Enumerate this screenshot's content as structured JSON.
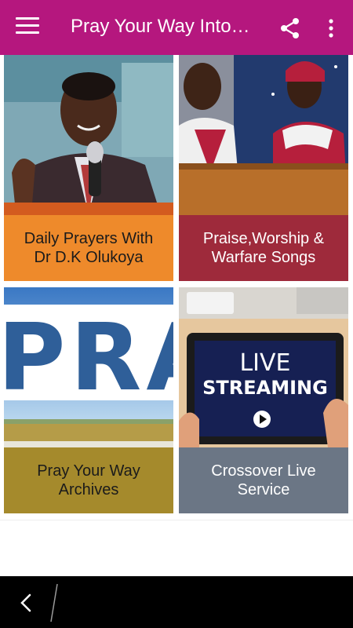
{
  "app_bar": {
    "title": "Pray Your Way Into…",
    "background_color": "#b5177e",
    "menu_icon": "hamburger-menu-icon",
    "share_icon": "share-icon",
    "more_icon": "more-vert-icon"
  },
  "tiles": [
    {
      "label_line1": "Daily Prayers With",
      "label_line2": "Dr D.K Olukoya",
      "label_color": "#ee8a2b",
      "image": "preacher-with-microphone"
    },
    {
      "label_line1": "Praise,Worship &",
      "label_line2": "Warfare Songs",
      "label_color": "#9e2a3b",
      "image": "choir-at-pulpit"
    },
    {
      "label_line1": "Pray Your Way",
      "label_line2": "Archives",
      "label_color": "#a58a2c",
      "image": "pray-letters-field"
    },
    {
      "label_line1": "Crossover Live",
      "label_line2": "Service",
      "label_color": "#6b7685",
      "image": "live-streaming-tablet",
      "image_text_1": "LIVE",
      "image_text_2": "STREAMING"
    }
  ],
  "nav_bar": {
    "back_icon": "back-chevron-icon"
  }
}
